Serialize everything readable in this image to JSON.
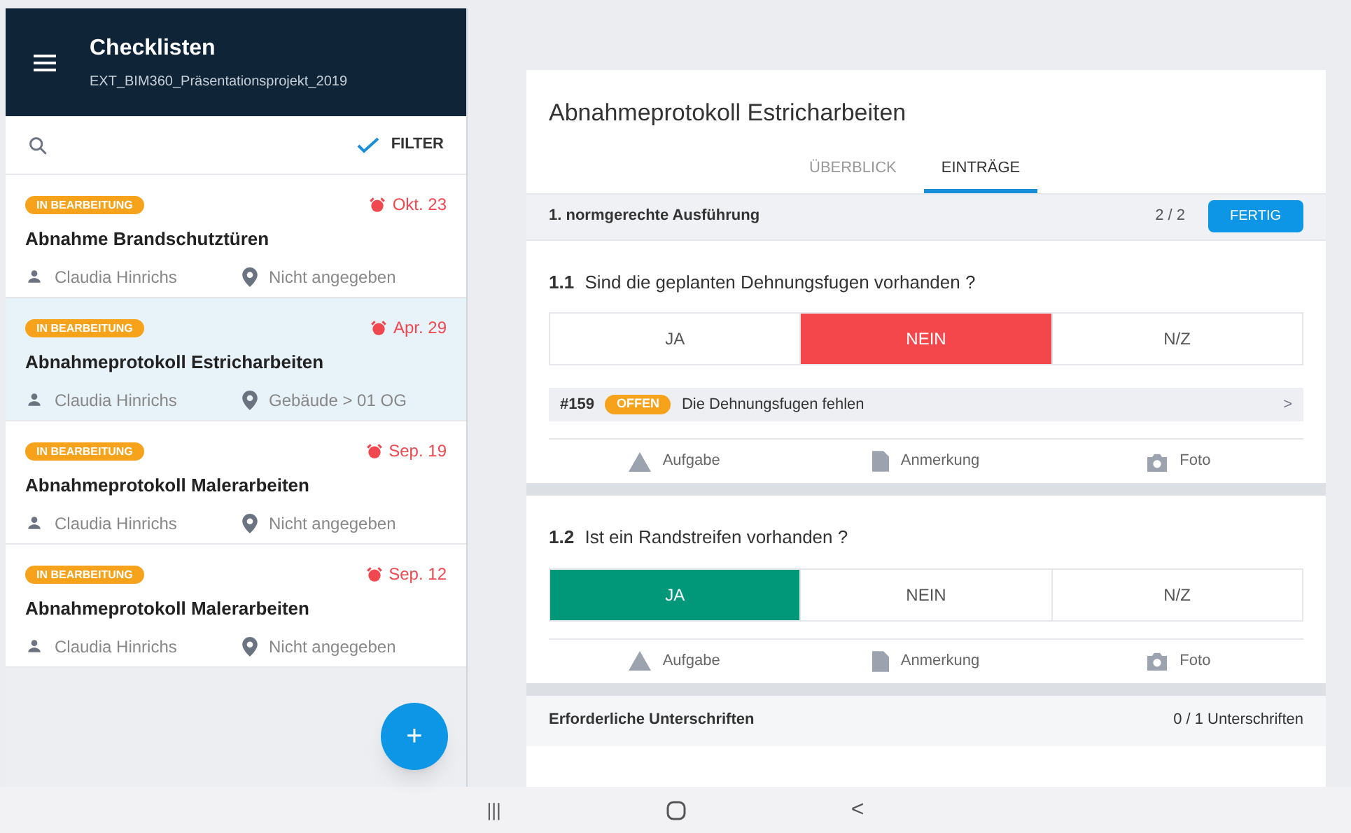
{
  "sidebar": {
    "title": "Checklisten",
    "subtitle": "EXT_BIM360_Präsentationsprojekt_2019",
    "filter": {
      "label": "FILTER",
      "on": true
    },
    "items": [
      {
        "status": "IN BEARBEITUNG",
        "date": "Okt. 23",
        "title": "Abnahme Brandschutztüren",
        "assignee": "Claudia Hinrichs",
        "location": "Nicht angegeben",
        "selected": false
      },
      {
        "status": "IN BEARBEITUNG",
        "date": "Apr. 29",
        "title": "Abnahmeprotokoll Estricharbeiten",
        "assignee": "Claudia Hinrichs",
        "location": "Gebäude > 01 OG",
        "selected": true
      },
      {
        "status": "IN BEARBEITUNG",
        "date": "Sep. 19",
        "title": "Abnahmeprotokoll Malerarbeiten",
        "assignee": "Claudia Hinrichs",
        "location": "Nicht angegeben",
        "selected": false
      },
      {
        "status": "IN BEARBEITUNG",
        "date": "Sep. 12",
        "title": "Abnahmeprotokoll Malerarbeiten",
        "assignee": "Claudia Hinrichs",
        "location": "Nicht angegeben",
        "selected": false
      }
    ],
    "fab": "+"
  },
  "detail": {
    "title": "Abnahmeprotokoll Estricharbeiten",
    "tabs": [
      {
        "label": "ÜBERBLICK",
        "selected": false
      },
      {
        "label": "EINTRÄGE",
        "selected": true
      }
    ],
    "section": {
      "title": "1. normgerechte Ausführung",
      "progress": "2 / 2",
      "button": "FERTIG"
    },
    "questions": [
      {
        "number": "1.1",
        "text": "Sind die geplanten Dehnungsfugen vorhanden ?",
        "options": [
          {
            "label": "JA",
            "kind": "yes",
            "selected": false
          },
          {
            "label": "NEIN",
            "kind": "no",
            "selected": true
          },
          {
            "label": "N/Z",
            "kind": "na",
            "selected": false
          }
        ],
        "issues": [
          {
            "id": "#159",
            "status": "OFFEN",
            "text": "Die Dehnungsfugen fehlen",
            "chevron": ">"
          }
        ],
        "actions": [
          "Aufgabe",
          "Anmerkung",
          "Foto"
        ]
      },
      {
        "number": "1.2",
        "text": "Ist ein Randstreifen vorhanden ?",
        "options": [
          {
            "label": "JA",
            "kind": "yes",
            "selected": true
          },
          {
            "label": "NEIN",
            "kind": "no",
            "selected": false
          },
          {
            "label": "N/Z",
            "kind": "na",
            "selected": false
          }
        ],
        "actions": [
          "Aufgabe",
          "Anmerkung",
          "Foto"
        ]
      }
    ],
    "signatures": {
      "label": "Erforderliche Unterschriften",
      "count": "0 / 1 Unterschriften"
    }
  },
  "nav_bar": {
    "recent": "|||",
    "back": "<"
  }
}
